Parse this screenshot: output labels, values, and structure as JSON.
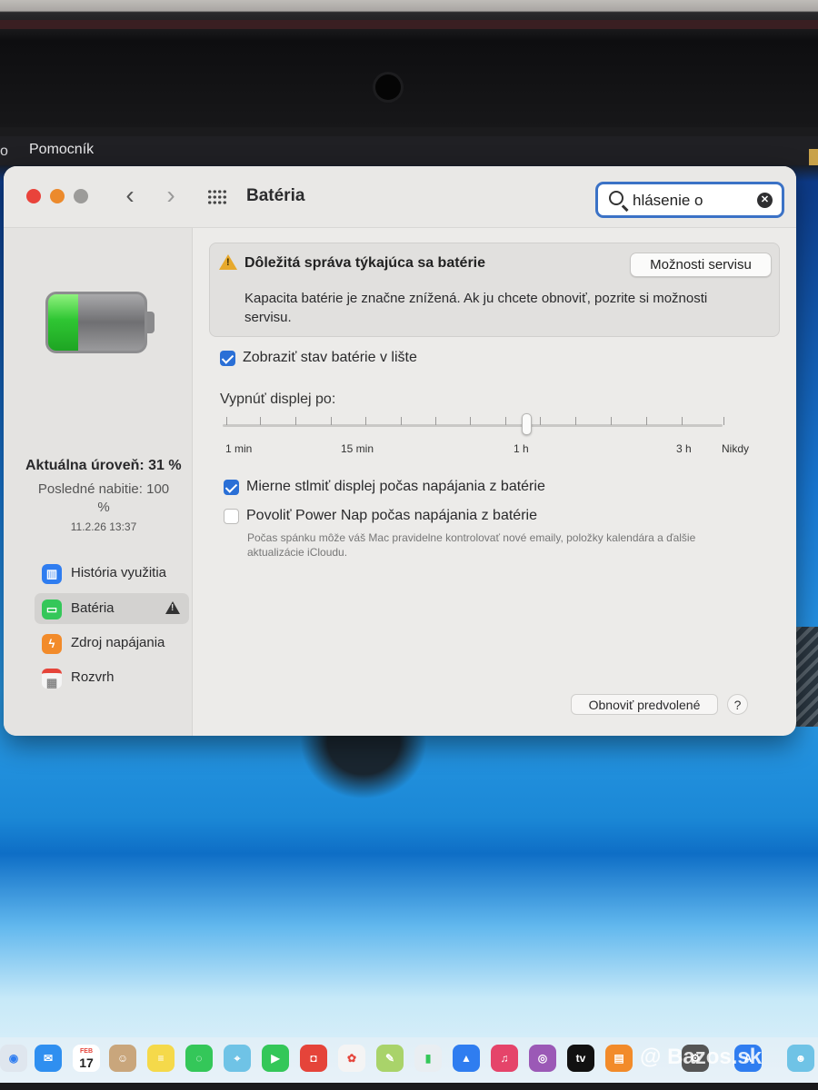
{
  "menubar": {
    "edge_text": "o",
    "help_menu": "Pomocník"
  },
  "window": {
    "title": "Batéria",
    "search": {
      "value": "hlásenie o",
      "clear_symbol": "✕"
    },
    "nav": {
      "back": "‹",
      "forward": "›"
    }
  },
  "sidebar": {
    "battery_level_fraction": 0.31,
    "level_text": "Aktuálna úroveň: 31 %",
    "last_charge_text": "Posledné nabitie: 100 %",
    "last_charge_date": "11.2.26 13:37",
    "items": [
      {
        "label": "História využitia",
        "icon": "chart-icon",
        "color": "#2f7df0",
        "selected": false
      },
      {
        "label": "Batéria",
        "icon": "battery-icon",
        "color": "#34c759",
        "selected": true,
        "warning": true
      },
      {
        "label": "Zdroj napájania",
        "icon": "bolt-icon",
        "color": "#f28b2a",
        "selected": false
      },
      {
        "label": "Rozvrh",
        "icon": "calendar-icon",
        "color": "#e5443a",
        "selected": false
      }
    ]
  },
  "alert": {
    "title": "Dôležitá správa týkajúca sa batérie",
    "button": "Možnosti servisu",
    "body": "Kapacita batérie je značne znížená. Ak ju chcete obnoviť, pozrite si možnosti servisu.",
    "icon_color": "#e7a92c"
  },
  "options": {
    "show_status": {
      "label": "Zobraziť stav batérie v lište",
      "checked": true
    },
    "display_off_label": "Vypnúť displej po:",
    "slider": {
      "labels": [
        "1 min",
        "15 min",
        "1 h",
        "3 h",
        "Nikdy"
      ],
      "value": "1 h"
    },
    "dim_display": {
      "label": "Mierne stlmiť displej počas napájania z batérie",
      "checked": true
    },
    "power_nap": {
      "label": "Povoliť Power Nap počas napájania z batérie",
      "checked": false,
      "description": "Počas spánku môže váš Mac pravidelne kontrolovať nové emaily, položky kalendára a ďalšie aktualizácie iCloudu."
    }
  },
  "footer": {
    "restore_button": "Obnoviť predvolené",
    "help_button": "?"
  },
  "dock": {
    "calendar_month": "FEB",
    "calendar_day": "17",
    "watermark": "@ Bazos.sk",
    "accent_colors": [
      "#2f7df0",
      "#34c759",
      "#e5443a",
      "#f28b2a",
      "#9b59b6"
    ]
  }
}
